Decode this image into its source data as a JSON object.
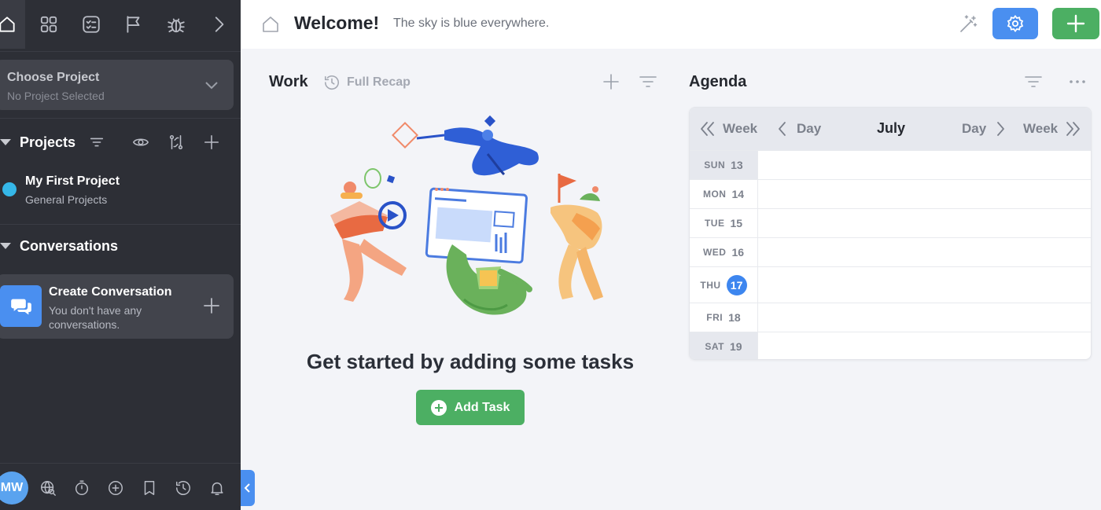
{
  "sidebar": {
    "choose_project": {
      "title": "Choose Project",
      "subtitle": "No Project Selected"
    },
    "projects": {
      "title": "Projects",
      "items": [
        {
          "name": "My First Project",
          "subtitle": "General Projects",
          "color": "#35b7e8"
        }
      ]
    },
    "conversations": {
      "title": "Conversations",
      "create": {
        "title": "Create Conversation",
        "subtitle": "You don't have any conversations."
      }
    },
    "user": {
      "initials": "MW"
    }
  },
  "header": {
    "title": "Welcome!",
    "subtitle": "The sky is blue everywhere."
  },
  "work": {
    "title": "Work",
    "recap_label": "Full Recap",
    "empty_title": "Get started by adding some tasks",
    "add_task_label": "Add Task"
  },
  "agenda": {
    "title": "Agenda",
    "month": "July",
    "nav": {
      "prev_week": "Week",
      "prev_day": "Day",
      "next_day": "Day",
      "next_week": "Week"
    },
    "days": [
      {
        "name": "SUN",
        "num": "13",
        "weekend": true,
        "today": false
      },
      {
        "name": "MON",
        "num": "14",
        "weekend": false,
        "today": false
      },
      {
        "name": "TUE",
        "num": "15",
        "weekend": false,
        "today": false
      },
      {
        "name": "WED",
        "num": "16",
        "weekend": false,
        "today": false
      },
      {
        "name": "THU",
        "num": "17",
        "weekend": false,
        "today": true
      },
      {
        "name": "FRI",
        "num": "18",
        "weekend": false,
        "today": false
      },
      {
        "name": "SAT",
        "num": "19",
        "weekend": true,
        "today": false
      }
    ]
  },
  "colors": {
    "accent_blue": "#4a8ff0",
    "accent_green": "#4caf63",
    "sidebar_bg": "#2d2f36"
  }
}
